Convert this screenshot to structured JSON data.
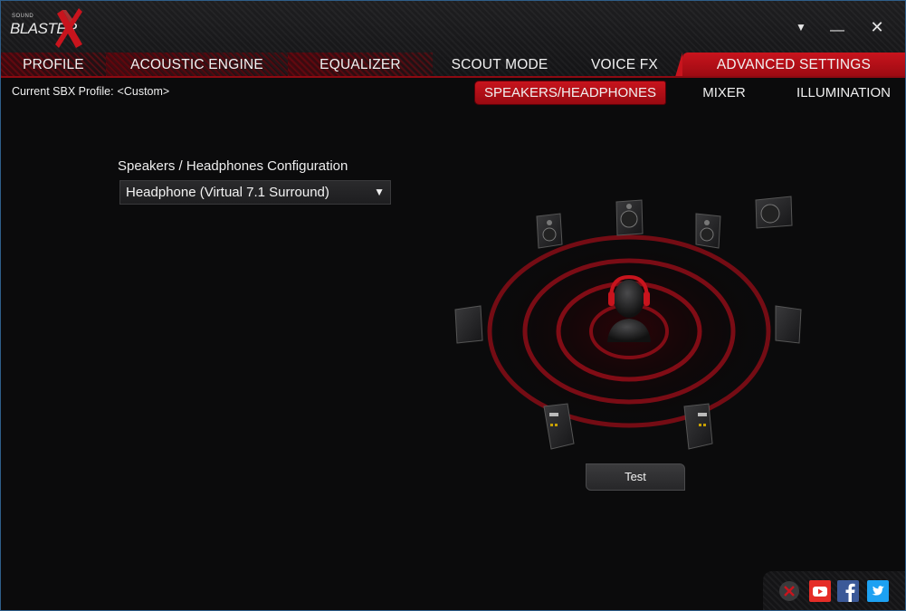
{
  "app": {
    "logo_small": "SOUND",
    "logo_word": "BLASTER"
  },
  "window_controls": {
    "dropdown": "▼",
    "minimize": "—",
    "close": "✕"
  },
  "tabs": [
    {
      "label": "PROFILE"
    },
    {
      "label": "ACOUSTIC ENGINE"
    },
    {
      "label": "EQUALIZER"
    },
    {
      "label": "SCOUT MODE"
    },
    {
      "label": "VOICE FX"
    },
    {
      "label": "ADVANCED SETTINGS",
      "active": true
    }
  ],
  "profile": {
    "label": "Current SBX Profile:",
    "value": "<Custom>"
  },
  "subtabs": [
    {
      "label": "SPEAKERS/HEADPHONES",
      "active": true
    },
    {
      "label": "MIXER"
    },
    {
      "label": "ILLUMINATION"
    }
  ],
  "config": {
    "label": "Speakers / Headphones Configuration",
    "selected": "Headphone (Virtual 7.1 Surround)"
  },
  "test_button": {
    "label": "Test"
  },
  "social": [
    "x-circle-icon",
    "youtube-icon",
    "facebook-icon",
    "twitter-icon"
  ],
  "colors": {
    "accent": "#c8141d",
    "background": "#0b0b0c",
    "youtube": "#e52d27",
    "facebook": "#3b5998",
    "twitter": "#1da1f2"
  }
}
